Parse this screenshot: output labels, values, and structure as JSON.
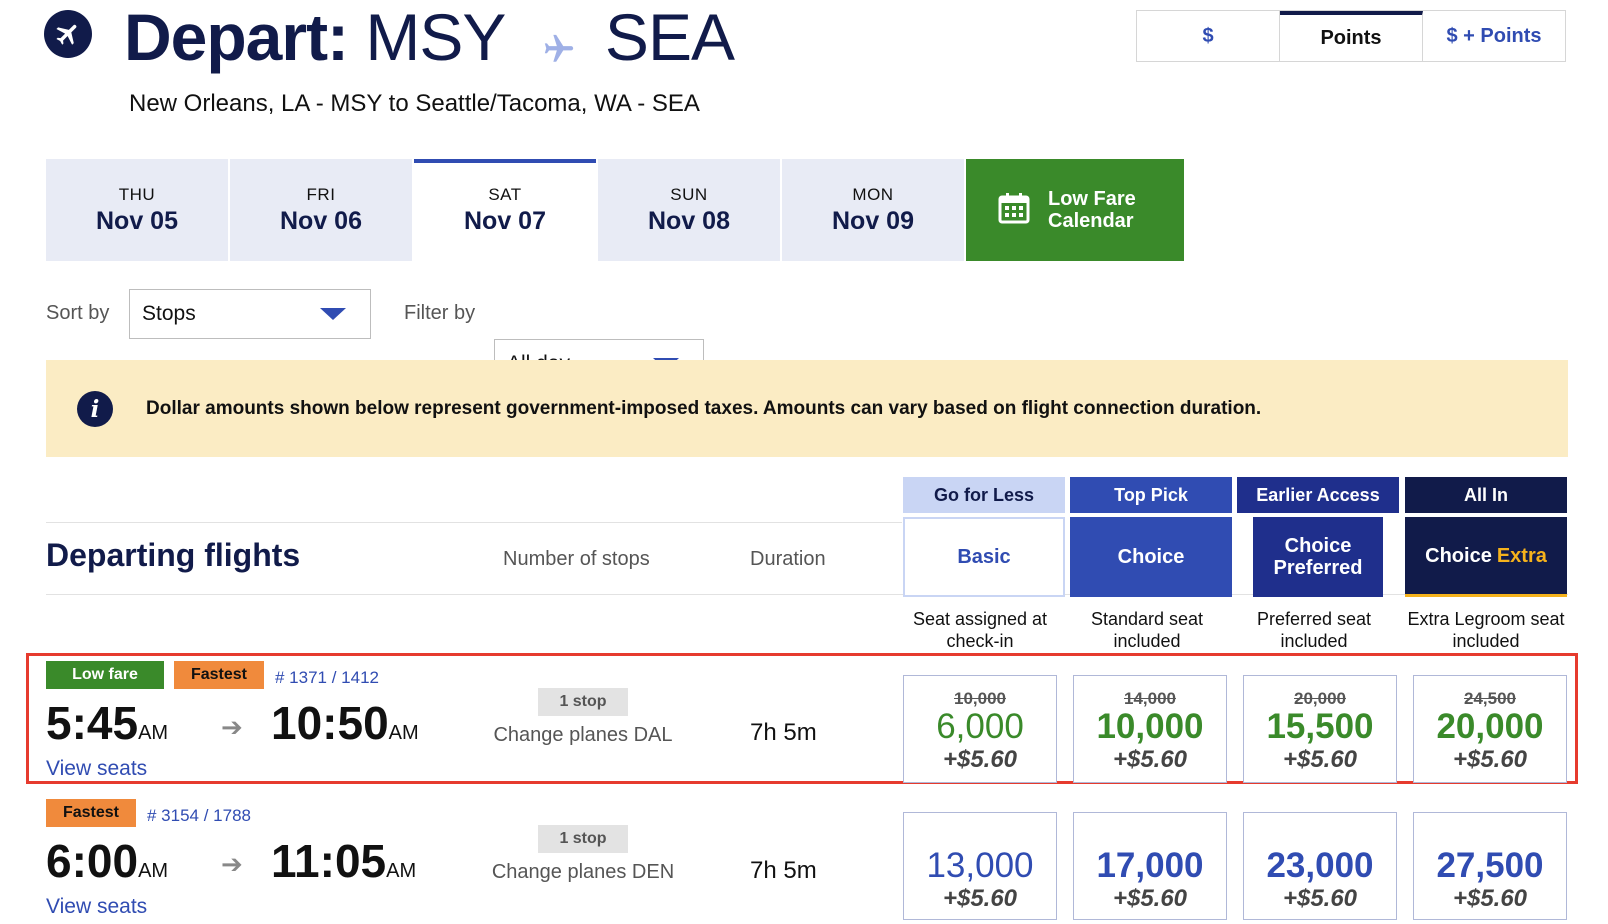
{
  "header": {
    "title_label": "Depart:",
    "origin": "MSY",
    "destination": "SEA",
    "subtitle": "New Orleans, LA - MSY to Seattle/Tacoma, WA - SEA",
    "icons": [
      "airplane-icon"
    ]
  },
  "fare_toggle": {
    "options": [
      "$",
      "Points",
      "$ + Points"
    ],
    "selected": "Points"
  },
  "date_tabs": [
    {
      "dow": "THU",
      "date": "Nov 05"
    },
    {
      "dow": "FRI",
      "date": "Nov 06"
    },
    {
      "dow": "SAT",
      "date": "Nov 07",
      "selected": true
    },
    {
      "dow": "SUN",
      "date": "Nov 08"
    },
    {
      "dow": "MON",
      "date": "Nov 09"
    }
  ],
  "low_fare_calendar": {
    "label": "Low Fare Calendar",
    "icon": "calendar-icon",
    "color": "#3a8a2a"
  },
  "sort": {
    "label": "Sort by",
    "value": "Stops"
  },
  "filter": {
    "label": "Filter by",
    "value": "All day"
  },
  "notice": {
    "icon": "info-icon",
    "text": "Dollar amounts shown below represent government-imposed taxes. Amounts can vary based on flight connection duration."
  },
  "columns": {
    "title": "Departing flights",
    "stops": "Number of stops",
    "duration": "Duration"
  },
  "fares": [
    {
      "tag": "Go for Less",
      "name": "Basic",
      "desc": "Seat assigned at check-in"
    },
    {
      "tag": "Top Pick",
      "name": "Choice",
      "desc": "Standard seat included"
    },
    {
      "tag": "Earlier Access",
      "name": "Choice Preferred",
      "desc": "Preferred seat included"
    },
    {
      "tag": "All In",
      "name": "Choice",
      "name_accent": "Extra",
      "desc": "Extra Legroom seat included"
    }
  ],
  "flights": [
    {
      "badges": [
        "Low fare",
        "Fastest"
      ],
      "flight_numbers": "# 1371 / 1412",
      "depart_time": "5:45",
      "depart_ampm": "AM",
      "arrive_time": "10:50",
      "arrive_ampm": "AM",
      "view_seats": "View seats",
      "stops": "1 stop",
      "change": "Change planes DAL",
      "duration": "7h 5m",
      "highlighted": true,
      "prices": [
        {
          "was": "10,000",
          "points": "6,000",
          "tax": "+$5.60"
        },
        {
          "was": "14,000",
          "points": "10,000",
          "tax": "+$5.60"
        },
        {
          "was": "20,000",
          "points": "15,500",
          "tax": "+$5.60"
        },
        {
          "was": "24,500",
          "points": "20,000",
          "tax": "+$5.60"
        }
      ]
    },
    {
      "badges": [
        "Fastest"
      ],
      "flight_numbers": "# 3154 / 1788",
      "depart_time": "6:00",
      "depart_ampm": "AM",
      "arrive_time": "11:05",
      "arrive_ampm": "AM",
      "view_seats": "View seats",
      "stops": "1 stop",
      "change": "Change planes DEN",
      "duration": "7h 5m",
      "highlighted": false,
      "prices": [
        {
          "points": "13,000",
          "tax": "+$5.60"
        },
        {
          "points": "17,000",
          "tax": "+$5.60"
        },
        {
          "points": "23,000",
          "tax": "+$5.60"
        },
        {
          "points": "27,500",
          "tax": "+$5.60"
        }
      ]
    }
  ],
  "colors": {
    "navy": "#111b4a",
    "blue": "#304cb2",
    "green": "#3a8a2a",
    "orange": "#f08a3c",
    "highlight_red": "#e63b2e",
    "notice_bg": "#fbecc4"
  }
}
